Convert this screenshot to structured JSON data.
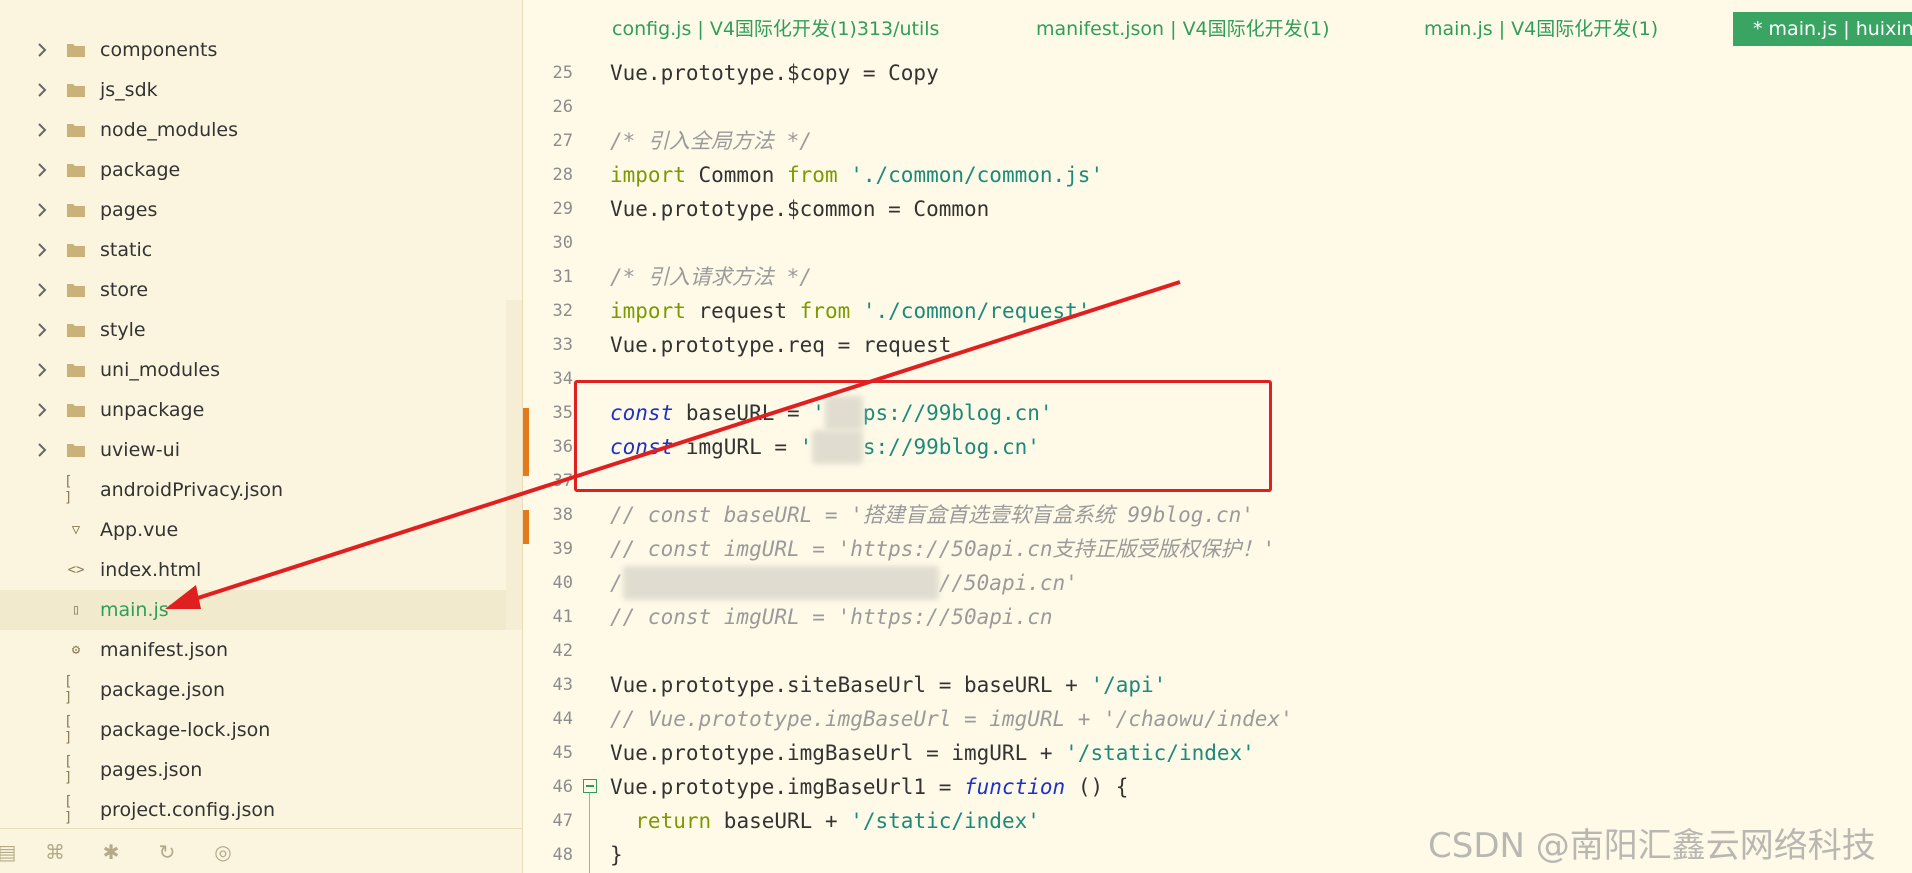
{
  "sidebar": {
    "items": [
      {
        "type": "folder",
        "label": "components"
      },
      {
        "type": "folder",
        "label": "js_sdk"
      },
      {
        "type": "folder",
        "label": "node_modules"
      },
      {
        "type": "folder",
        "label": "package"
      },
      {
        "type": "folder",
        "label": "pages"
      },
      {
        "type": "folder",
        "label": "static"
      },
      {
        "type": "folder",
        "label": "store"
      },
      {
        "type": "folder",
        "label": "style"
      },
      {
        "type": "folder",
        "label": "uni_modules"
      },
      {
        "type": "folder",
        "label": "unpackage"
      },
      {
        "type": "folder",
        "label": "uview-ui"
      },
      {
        "type": "json",
        "label": "androidPrivacy.json"
      },
      {
        "type": "vue",
        "label": "App.vue"
      },
      {
        "type": "html",
        "label": "index.html"
      },
      {
        "type": "js",
        "label": "main.js",
        "selected": true
      },
      {
        "type": "manifest",
        "label": "manifest.json"
      },
      {
        "type": "json",
        "label": "package.json"
      },
      {
        "type": "json",
        "label": "package-lock.json"
      },
      {
        "type": "json",
        "label": "pages.json"
      },
      {
        "type": "json",
        "label": "project.config.json"
      }
    ],
    "bottom_icons": [
      "panel-icon",
      "gamepad-icon",
      "bug-icon",
      "refresh-icon",
      "globe-icon"
    ]
  },
  "tabs": [
    {
      "label": "config.js | V4国际化开发(1)313/utils",
      "active": false
    },
    {
      "label": "manifest.json | V4国际化开发(1)",
      "active": false
    },
    {
      "label": "main.js | V4国际化开发(1)",
      "active": false
    },
    {
      "label": "* main.js | huixiny",
      "active": true
    }
  ],
  "code_lines": {
    "l25": {
      "num": "25",
      "a": "Vue.prototype.$copy = Copy"
    },
    "l26": {
      "num": "26"
    },
    "l27": {
      "num": "27",
      "c": "/* 引入全局方法 */"
    },
    "l28": {
      "num": "28",
      "kw": "import",
      "a": " Common ",
      "kw2": "from",
      "s": " './common/common.js'"
    },
    "l29": {
      "num": "29",
      "a": "Vue.prototype.$common = Common"
    },
    "l30": {
      "num": "30"
    },
    "l31": {
      "num": "31",
      "c": "/* 引入请求方法 */"
    },
    "l32": {
      "num": "32",
      "kw": "import",
      "a": " request ",
      "kw2": "from",
      "s": " './common/request'"
    },
    "l33": {
      "num": "33",
      "a": "Vue.prototype.req = request"
    },
    "l34": {
      "num": "34"
    },
    "l35": {
      "num": "35",
      "kw": "const",
      "a": " baseURL = ",
      "s": "'",
      "s2": "ps://99blog.cn'"
    },
    "l36": {
      "num": "36",
      "kw": "const",
      "a": " imgURL = ",
      "s": "'",
      "s2": "s://99blog.cn'"
    },
    "l37": {
      "num": "37"
    },
    "l38": {
      "num": "38",
      "c": "// const baseURL = '搭建盲盒首选壹软盲盒系统 99blog.cn'"
    },
    "l39": {
      "num": "39",
      "c": "// const imgURL = 'https://50api.cn支持正版受版权保护！'"
    },
    "l40": {
      "num": "40",
      "c": "/",
      "c2": "//50api.cn'"
    },
    "l41": {
      "num": "41",
      "c": "// const imgURL = 'https://50api.cn"
    },
    "l42": {
      "num": "42"
    },
    "l43": {
      "num": "43",
      "a": "Vue.prototype.siteBaseUrl = baseURL + ",
      "s": "'/api'"
    },
    "l44": {
      "num": "44",
      "c": "// Vue.prototype.imgBaseUrl = imgURL + '/chaowu/index'"
    },
    "l45": {
      "num": "45",
      "a": "Vue.prototype.imgBaseUrl = imgURL + ",
      "s": "'/static/index'"
    },
    "l46": {
      "num": "46",
      "a": "Vue.prototype.imgBaseUrl1 = ",
      "kw": "function",
      "a2": " () {"
    },
    "l47": {
      "num": "47",
      "kw": "  return",
      "a": " baseURL + ",
      "s": "'/static/index'"
    },
    "l48": {
      "num": "48",
      "a": "}"
    }
  },
  "watermark": "CSDN @南阳汇鑫云网络科技",
  "colors": {
    "accent_green": "#2f9e59",
    "annotation_red": "#e02020",
    "background": "#fffae8"
  }
}
